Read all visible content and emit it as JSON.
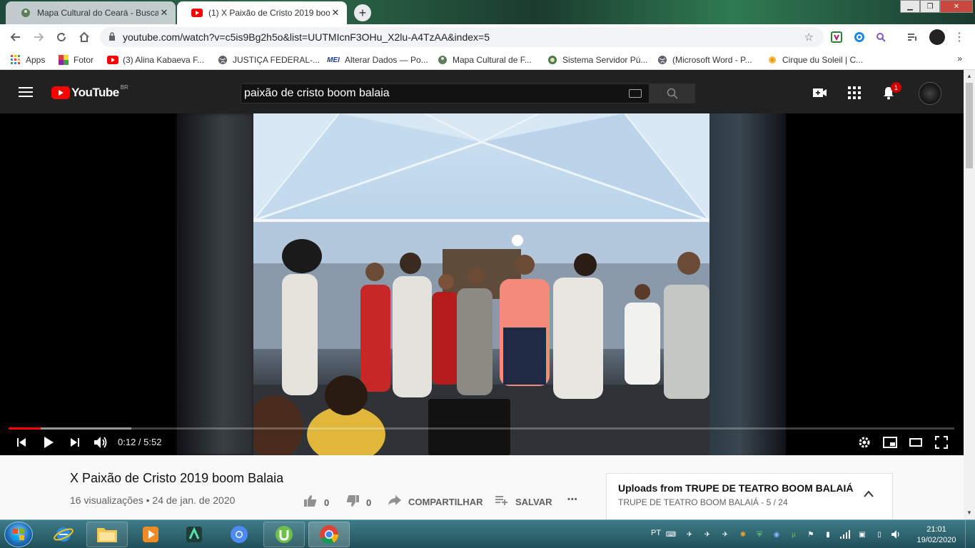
{
  "browser": {
    "tabs": [
      {
        "title": "Mapa Cultural do Ceará - Busca",
        "active": false
      },
      {
        "title": "(1) X Paixão de Cristo 2019 boom",
        "active": true
      }
    ],
    "new_tab": "+",
    "url": "youtube.com/watch?v=c5is9Bg2h5o&list=UUTMIcnF3OHu_X2lu-A4TzAA&index=5",
    "bookmarks": [
      {
        "label": "Apps"
      },
      {
        "label": "Fotor"
      },
      {
        "label": "(3) Alina Kabaeva F..."
      },
      {
        "label": "JUSTIÇA FEDERAL-..."
      },
      {
        "label": "Alterar Dados — Po..."
      },
      {
        "label": "Mapa Cultural de F..."
      },
      {
        "label": "Sistema Servidor Pú..."
      },
      {
        "label": "(Microsoft Word - P..."
      },
      {
        "label": "Cirque du Soleil | C..."
      }
    ],
    "bookmarks_more": "»",
    "mei_text": "MEI"
  },
  "youtube": {
    "logo_text": "YouTube",
    "country_code": "BR",
    "search_value": "paixão de cristo boom balaia",
    "notification_count": "1",
    "player": {
      "time_label": "0:12 / 5:52",
      "played_fraction": 0.034,
      "buffered_fraction": 0.13
    },
    "video_title": "X Paixão de Cristo 2019 boom Balaia",
    "views_date": "16 visualizações • 24 de jan. de 2020",
    "actions": {
      "likes": "0",
      "dislikes": "0",
      "share": "COMPARTILHAR",
      "save": "SALVAR",
      "more": "•••"
    },
    "playlist": {
      "title": "Uploads from TRUPE DE TEATRO BOOM BALAIÁ",
      "subtitle": "TRUPE DE TEATRO BOOM BALAIÁ - 5 / 24"
    }
  },
  "taskbar": {
    "language": "PT",
    "time": "21:01",
    "date": "19/02/2020"
  },
  "colors": {
    "youtube_red": "#ff0000",
    "masthead": "#212121",
    "chrome_inactive_tab": "#dee1e6"
  }
}
